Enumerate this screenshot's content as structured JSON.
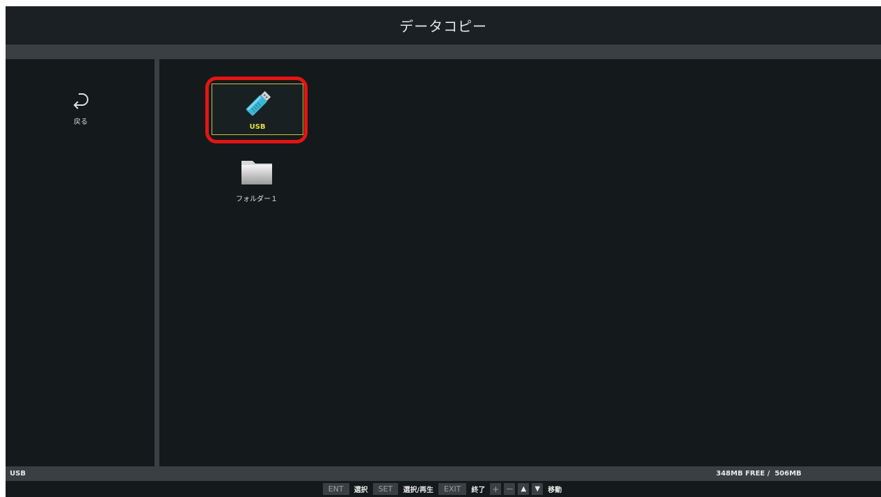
{
  "title": "データコピー",
  "sidebar": {
    "back_label": "戻る",
    "back_icon": "return-arrow-icon"
  },
  "main": {
    "items": [
      {
        "label": "USB",
        "icon": "usb-drive-icon",
        "selected": true,
        "label_color": "#e6df3c"
      },
      {
        "label": "フォルダー１",
        "icon": "folder-icon",
        "selected": false
      }
    ],
    "highlight_color": "#e51414"
  },
  "status": {
    "source": "USB",
    "storage": "348MB FREE /  506MB"
  },
  "keys": {
    "ent": "ENT",
    "ent_desc": "選択",
    "set": "SET",
    "set_desc": "選択/再生",
    "exit": "EXIT",
    "exit_desc": "終了",
    "plus": "+",
    "minus": "－",
    "up": "▲",
    "down": "▼",
    "move_desc": "移動"
  },
  "colors": {
    "background": "#141a1c",
    "bar": "#3a3f43",
    "accent_yellow": "#c8c23a",
    "usb_blue": "#3ab7d6"
  }
}
